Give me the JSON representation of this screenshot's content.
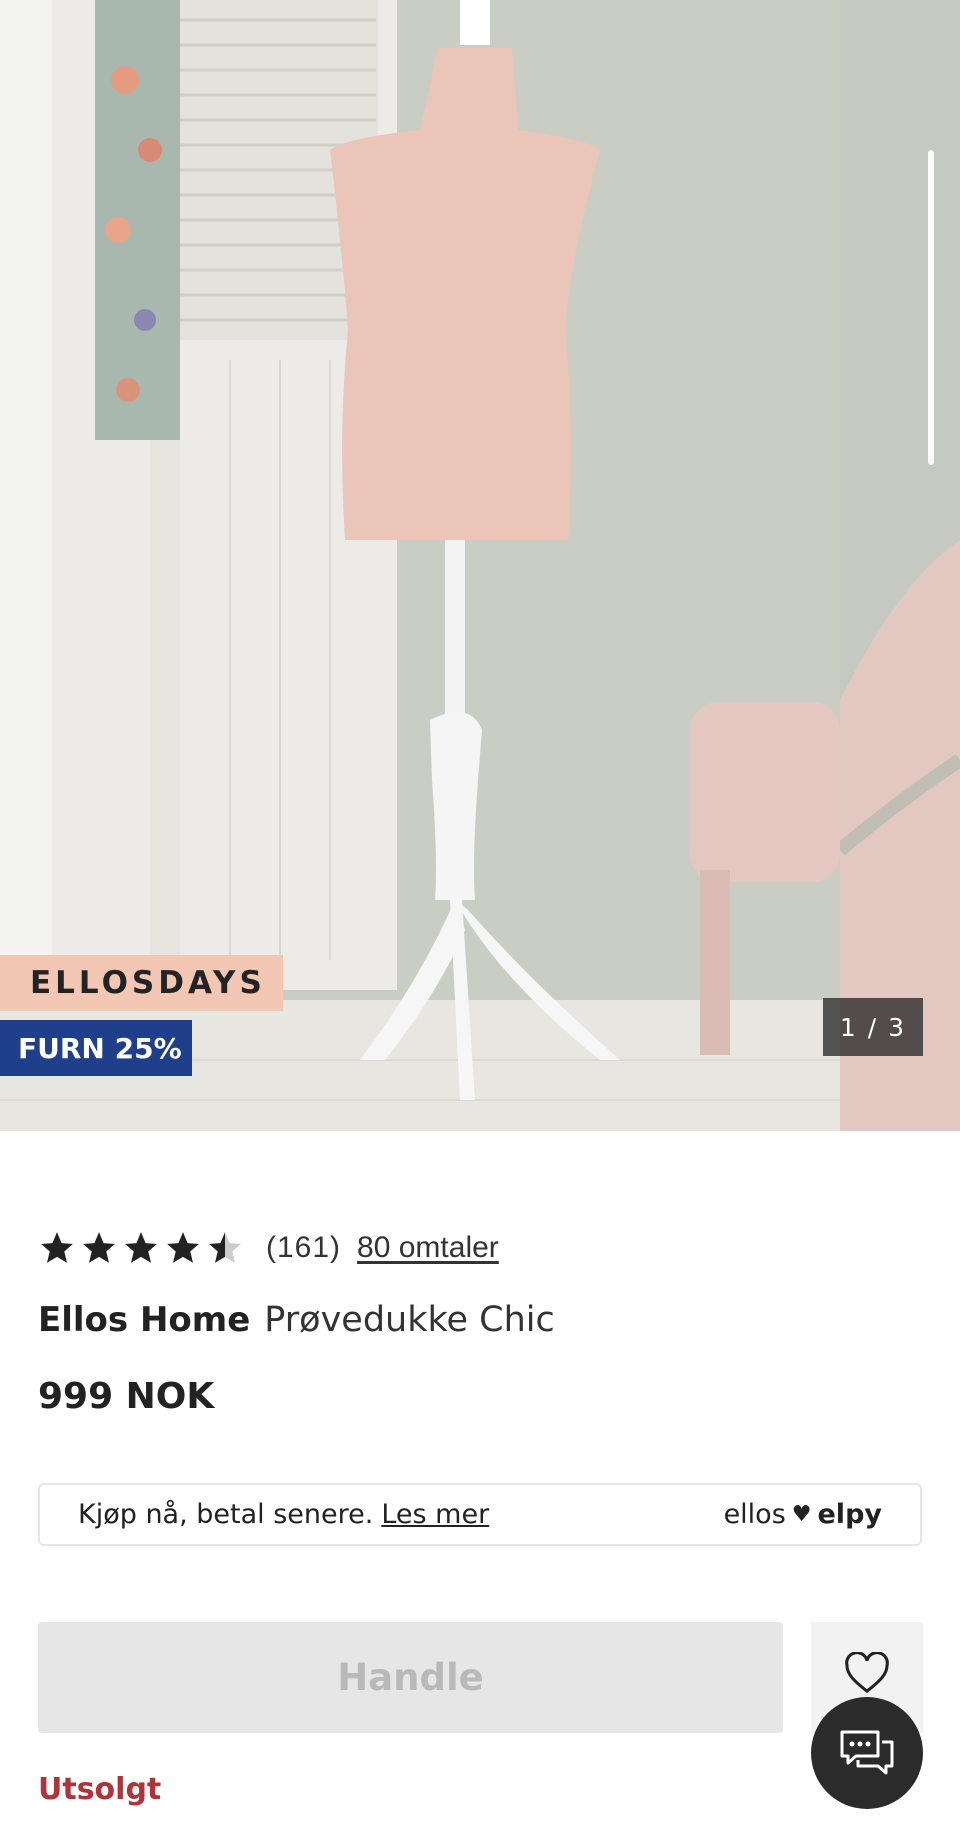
{
  "gallery": {
    "promo_top": "ELLOSDAYS",
    "promo_bottom": "FURN 25%",
    "counter": "1 / 3"
  },
  "rating": {
    "stars": 4.5,
    "count_text": "(161)",
    "reviews_link": "80 omtaler"
  },
  "product": {
    "brand": "Ellos Home",
    "name": "Prøvedukke Chic",
    "price": "999 NOK"
  },
  "bnpl": {
    "text": "Kjøp nå, betal senere.",
    "link": "Les mer",
    "logo_left": "ellos",
    "logo_right": "elpy"
  },
  "actions": {
    "buy_label": "Handle",
    "status": "Utsolgt"
  },
  "colors": {
    "promo_top_bg": "#f2c7b3",
    "promo_bottom_bg": "#1f3f8b",
    "sold_out": "#b0333a",
    "buy_disabled_bg": "#e6e6e6"
  },
  "icons": [
    "star-icon",
    "heart-icon",
    "chat-icon"
  ]
}
